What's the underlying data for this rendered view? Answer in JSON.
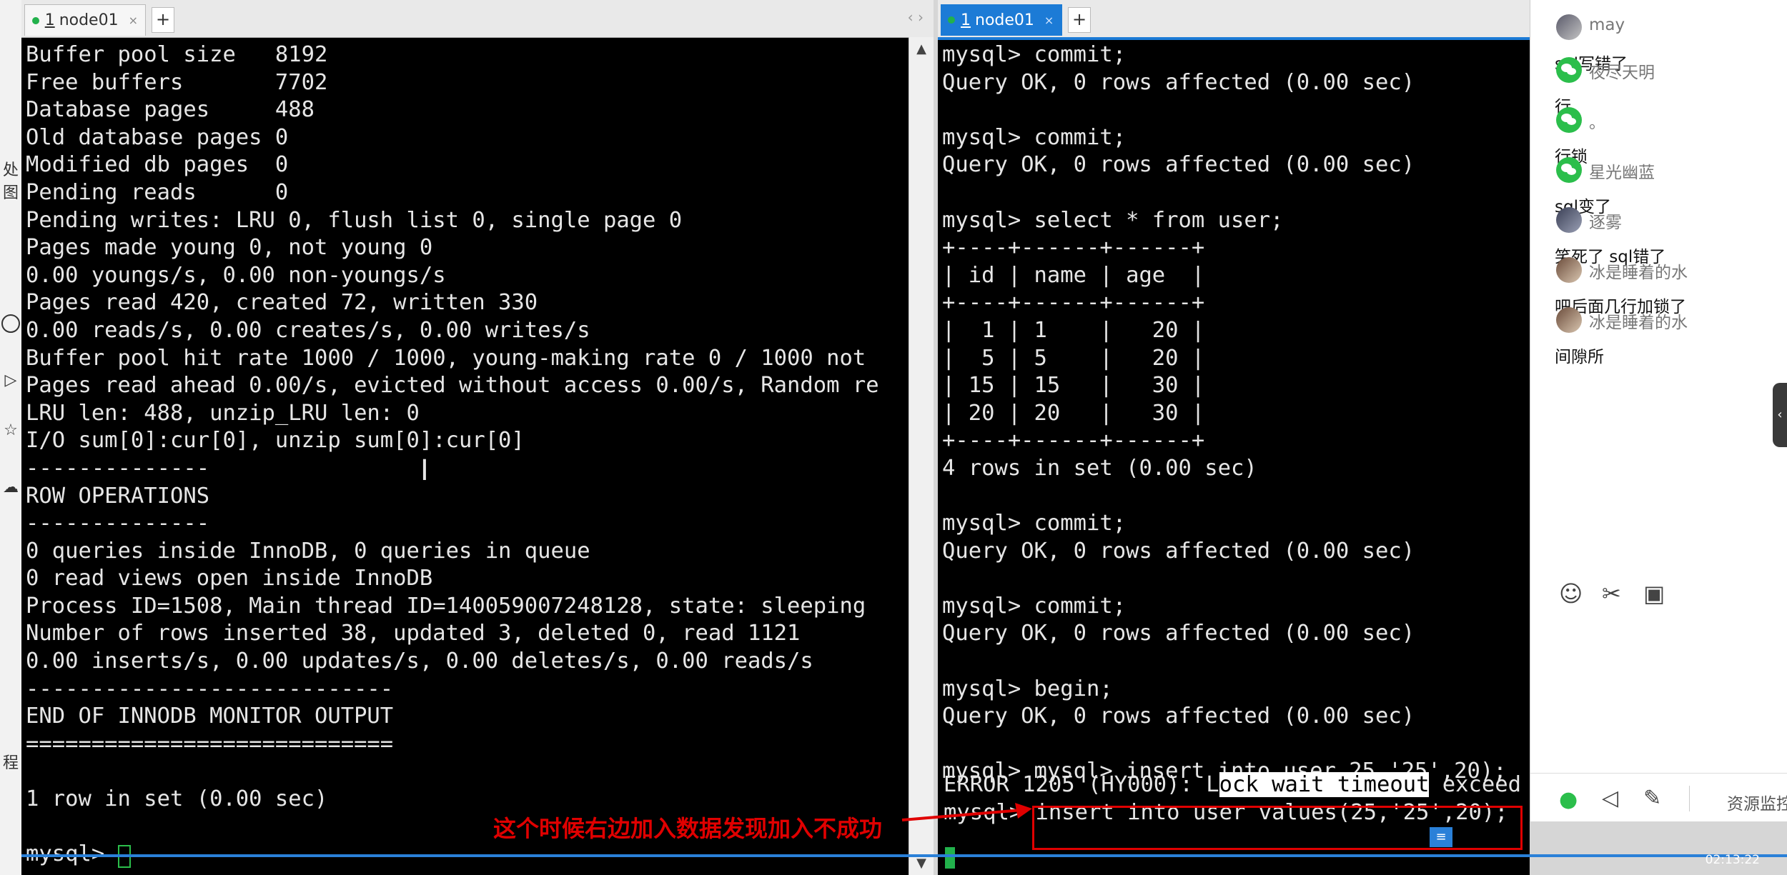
{
  "left_strip": {
    "chars": [
      "处",
      "图",
      "程"
    ]
  },
  "left_pane": {
    "tab_num": "1",
    "tab_name": "node01",
    "tab_close": "×",
    "add_tab": "+",
    "nav_arrows": "‹ ›",
    "lines": [
      "Buffer pool size   8192",
      "Free buffers       7702",
      "Database pages     488",
      "Old database pages 0",
      "Modified db pages  0",
      "Pending reads      0",
      "Pending writes: LRU 0, flush list 0, single page 0",
      "Pages made young 0, not young 0",
      "0.00 youngs/s, 0.00 non-youngs/s",
      "Pages read 420, created 72, written 330",
      "0.00 reads/s, 0.00 creates/s, 0.00 writes/s",
      "Buffer pool hit rate 1000 / 1000, young-making rate 0 / 1000 not",
      "Pages read ahead 0.00/s, evicted without access 0.00/s, Random re",
      "LRU len: 488, unzip_LRU len: 0",
      "I/O sum[0]:cur[0], unzip sum[0]:cur[0]",
      "--------------",
      "ROW OPERATIONS",
      "--------------",
      "0 queries inside InnoDB, 0 queries in queue",
      "0 read views open inside InnoDB",
      "Process ID=1508, Main thread ID=140059007248128, state: sleeping",
      "Number of rows inserted 38, updated 3, deleted 0, read 1121",
      "0.00 inserts/s, 0.00 updates/s, 0.00 deletes/s, 0.00 reads/s",
      "----------------------------",
      "END OF INNODB MONITOR OUTPUT",
      "============================",
      "",
      "1 row in set (0.00 sec)",
      "",
      "mysql> "
    ]
  },
  "right_pane": {
    "tab_num": "1",
    "tab_name": "node01",
    "tab_close": "×",
    "add_tab": "+",
    "lines": [
      "mysql> commit;",
      "Query OK, 0 rows affected (0.00 sec)",
      "",
      "mysql> commit;",
      "Query OK, 0 rows affected (0.00 sec)",
      "",
      "mysql> select * from user;",
      "+----+------+------+",
      "| id | name | age  |",
      "+----+------+------+",
      "|  1 | 1    |   20 |",
      "|  5 | 5    |   20 |",
      "| 15 | 15   |   30 |",
      "| 20 | 20   |   30 |",
      "+----+------+------+",
      "4 rows in set (0.00 sec)",
      "",
      "mysql> commit;",
      "Query OK, 0 rows affected (0.00 sec)",
      "",
      "mysql> commit;",
      "Query OK, 0 rows affected (0.00 sec)",
      "",
      "mysql> begin;",
      "Query OK, 0 rows affected (0.00 sec)",
      "",
      "mysql> mysql> insert into user 25,'25',20);"
    ],
    "error_prefix": "ERROR 1205 (HY000): L",
    "error_highlight": "ock wait timeout",
    "error_suffix": " exceed",
    "last_prompt": "mysql> ",
    "last_command": "insert into user values(25,'25',20);"
  },
  "chat": {
    "messages": [
      {
        "name": "may",
        "text": "sql写错了",
        "avatar": "photo"
      },
      {
        "name": "夜尽天明",
        "text": "行",
        "avatar": "wechat"
      },
      {
        "name": "。",
        "text": "行锁",
        "avatar": "wechat"
      },
      {
        "name": "星光幽蓝",
        "text": "sql变了",
        "avatar": "wechat"
      },
      {
        "name": "逐雾",
        "text": "笑死了 sql错了",
        "avatar": "photo2"
      },
      {
        "name": "冰是睡着的水",
        "text": "吧后面几行加锁了",
        "avatar": "photo3"
      },
      {
        "name": "冰是睡着的水",
        "text": "间隙所",
        "avatar": "photo3"
      }
    ],
    "toolbar_icons": [
      "smile-icon",
      "scissors-icon",
      "image-icon"
    ],
    "bottom_icons": [
      "mic-icon",
      "speaker-icon",
      "pen-icon"
    ],
    "resource_label": "资源监控",
    "collapse": "‹"
  },
  "annotation": "这个时候右边加入数据发现加入不成功",
  "video_time": "02:13:22",
  "colors": {
    "accent": "#1c7bd6",
    "annotation": "#e00000",
    "wechat": "#2bbe4b"
  }
}
